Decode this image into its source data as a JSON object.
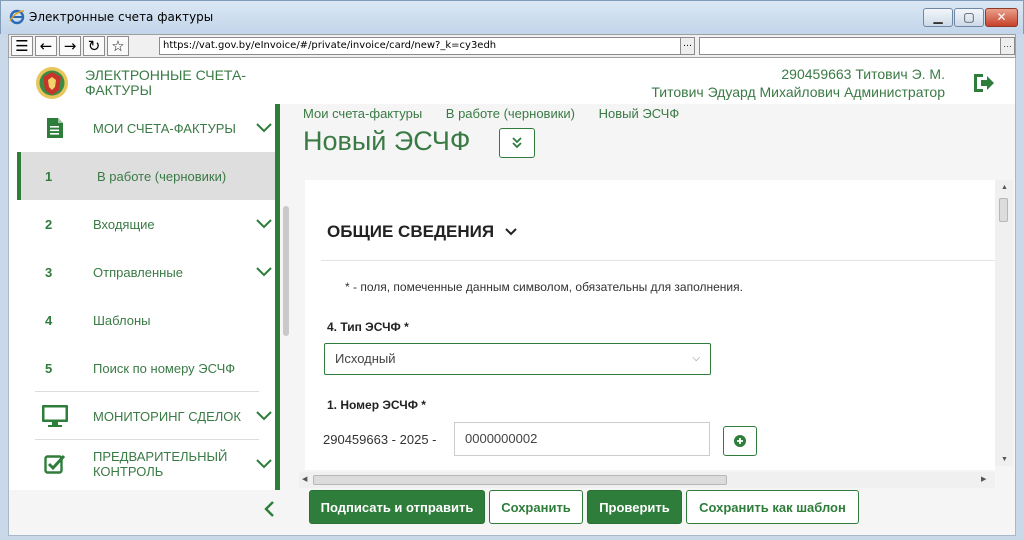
{
  "window": {
    "title": "Электронные счета фактуры"
  },
  "browser": {
    "url": "https://vat.gov.by/eInvoice/#/private/invoice/card/new?_k=cy3edh"
  },
  "header": {
    "brand": "ЭЛЕКТРОННЫЕ СЧЕТА-ФАКТУРЫ",
    "user_id": "290459663 Титович Э. М.",
    "user_name": "Титович Эдуард Михайлович Администратор"
  },
  "sidebar": {
    "my_invoices": "МОИ СЧЕТА-ФАКТУРЫ",
    "items": [
      {
        "num": "1",
        "label": "В работе (черновики)"
      },
      {
        "num": "2",
        "label": "Входящие"
      },
      {
        "num": "3",
        "label": "Отправленные"
      },
      {
        "num": "4",
        "label": "Шаблоны"
      },
      {
        "num": "5",
        "label": "Поиск по номеру ЭСЧФ"
      }
    ],
    "monitoring": "МОНИТОРИНГ СДЕЛОК",
    "precontrol": "ПРЕДВАРИТЕЛЬНЫЙ КОНТРОЛЬ"
  },
  "breadcrumbs": [
    "Мои счета-фактуры",
    "В работе (черновики)",
    "Новый ЭСЧФ"
  ],
  "page_title": "Новый ЭСЧФ",
  "form": {
    "section_title": "ОБЩИЕ СВЕДЕНИЯ",
    "required_note": "* - поля, помеченные данным символом, обязательны для заполнения.",
    "type_label": "4. Тип ЭСЧФ *",
    "type_value": "Исходный",
    "number_label": "1. Номер ЭСЧФ *",
    "number_prefix": "290459663  - 2025  -",
    "number_value": "0000000002"
  },
  "actions": {
    "sign_send": "Подписать и отправить",
    "save": "Сохранить",
    "check": "Проверить",
    "save_template": "Сохранить как шаблон"
  },
  "colors": {
    "accent": "#2e7d3a"
  }
}
